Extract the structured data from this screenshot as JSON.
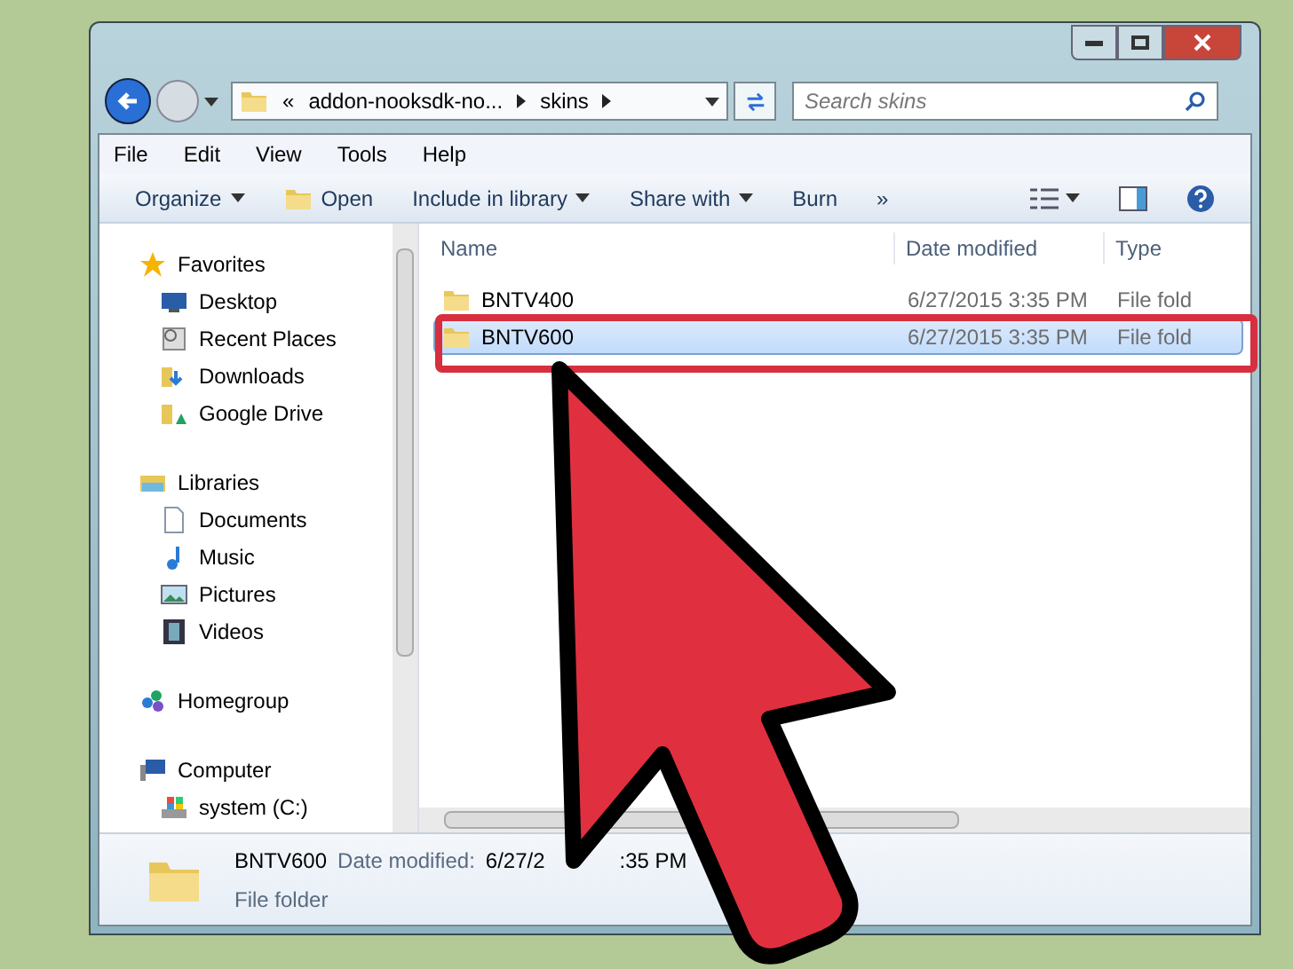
{
  "address": {
    "overflow": "«",
    "crumbs": [
      "addon-nooksdk-no...",
      "skins"
    ]
  },
  "search": {
    "placeholder": "Search skins"
  },
  "menu": [
    "File",
    "Edit",
    "View",
    "Tools",
    "Help"
  ],
  "toolbar": [
    {
      "label": "Organize",
      "kind": "dropdown"
    },
    {
      "label": "Open",
      "kind": "icon"
    },
    {
      "label": "Include in library",
      "kind": "dropdown"
    },
    {
      "label": "Share with",
      "kind": "dropdown"
    },
    {
      "label": "Burn",
      "kind": "plain"
    },
    {
      "label": "»",
      "kind": "plain"
    }
  ],
  "sidebar": [
    {
      "label": "Favorites",
      "children": [
        {
          "label": "Desktop"
        },
        {
          "label": "Recent Places"
        },
        {
          "label": "Downloads"
        },
        {
          "label": "Google Drive"
        }
      ]
    },
    {
      "label": "Libraries",
      "children": [
        {
          "label": "Documents"
        },
        {
          "label": "Music"
        },
        {
          "label": "Pictures"
        },
        {
          "label": "Videos"
        }
      ]
    },
    {
      "label": "Homegroup"
    },
    {
      "label": "Computer",
      "children": [
        {
          "label": "system (C:)"
        }
      ]
    }
  ],
  "table": {
    "columns": [
      "Name",
      "Date modified",
      "Type"
    ],
    "rows": [
      {
        "name": "BNTV400",
        "date": "6/27/2015 3:35 PM",
        "type": "File fold",
        "selected": false
      },
      {
        "name": "BNTV600",
        "date": "6/27/2015 3:35 PM",
        "type": "File fold",
        "selected": true
      }
    ]
  },
  "details": {
    "name": "BNTV600",
    "date_label": "Date modified:",
    "date_visible_parts": [
      "6/27/2",
      ":35 PM"
    ],
    "type": "File folder"
  }
}
